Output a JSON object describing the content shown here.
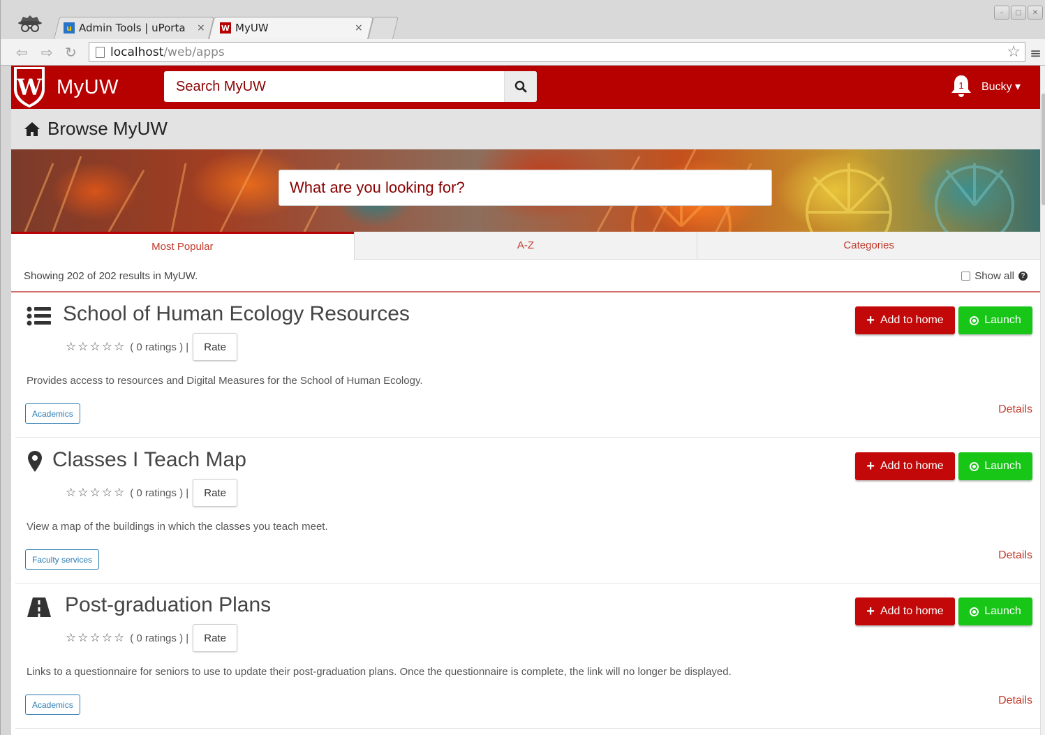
{
  "browser": {
    "tabs": [
      {
        "title": "Admin Tools | uPorta",
        "close": "×"
      },
      {
        "title": "MyUW",
        "close": "×"
      }
    ],
    "url_host": "localhost",
    "url_path": "/web/apps"
  },
  "header": {
    "brand": "MyUW",
    "search_placeholder": "Search MyUW",
    "notification_count": "1",
    "user_name": "Bucky"
  },
  "page": {
    "title": "Browse MyUW",
    "hero_search_placeholder": "What are you looking for?"
  },
  "tabs": [
    {
      "label": "Most Popular",
      "active": true
    },
    {
      "label": "A-Z",
      "active": false
    },
    {
      "label": "Categories",
      "active": false
    }
  ],
  "results": {
    "summary": "Showing 202 of 202 results in MyUW.",
    "show_all_label": "Show all"
  },
  "apps": [
    {
      "title": "School of Human Ecology Resources",
      "icon": "list-icon",
      "ratings": "( 0 ratings ) |",
      "rating_value": 0,
      "rate_label": "Rate",
      "description": "Provides access to resources and Digital Measures for the School of Human Ecology.",
      "tag": "Academics",
      "add_label": "Add to home",
      "launch_label": "Launch",
      "details_label": "Details"
    },
    {
      "title": "Classes I Teach Map",
      "icon": "map-marker-icon",
      "ratings": "( 0 ratings ) |",
      "rating_value": 0,
      "rate_label": "Rate",
      "description": "View a map of the buildings in which the classes you teach meet.",
      "tag": "Faculty services",
      "add_label": "Add to home",
      "launch_label": "Launch",
      "details_label": "Details"
    },
    {
      "title": "Post-graduation Plans",
      "icon": "road-icon",
      "ratings": "( 0 ratings ) |",
      "rating_value": 0,
      "rate_label": "Rate",
      "description": "Links to a questionnaire for seniors to use to update their post-graduation plans. Once the questionnaire is complete, the link will no longer be displayed.",
      "tag": "Academics",
      "add_label": "Add to home",
      "launch_label": "Launch",
      "details_label": "Details"
    }
  ],
  "colors": {
    "brand_red": "#b70101",
    "button_red": "#c20808",
    "launch_green": "#17c617",
    "link_red": "#c0392b",
    "tag_blue": "#2a7bb0"
  }
}
